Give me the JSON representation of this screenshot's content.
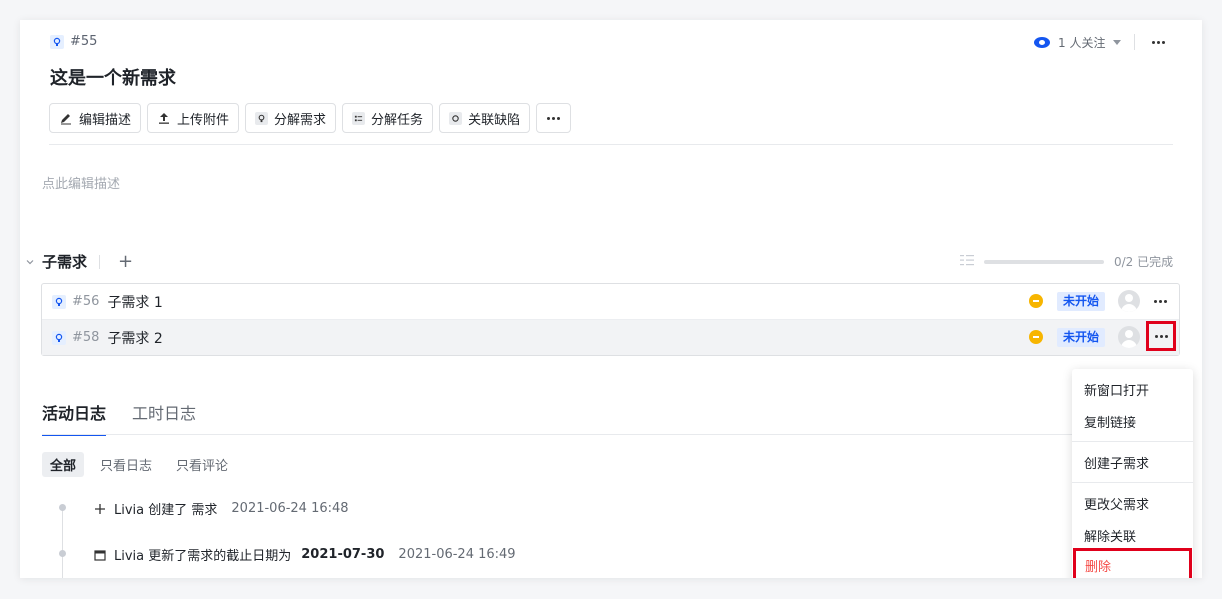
{
  "header": {
    "id": "#55",
    "title": "这是一个新需求",
    "watchers": "1 人关注"
  },
  "toolbar": {
    "edit_desc": "编辑描述",
    "upload": "上传附件",
    "split_req": "分解需求",
    "split_task": "分解任务",
    "link_bug": "关联缺陷"
  },
  "description": {
    "placeholder": "点此编辑描述"
  },
  "children": {
    "heading": "子需求",
    "progress": "0/2 已完成",
    "progress_value": 0,
    "items": [
      {
        "id": "#56",
        "name": "子需求 1",
        "status": "未开始"
      },
      {
        "id": "#58",
        "name": "子需求 2",
        "status": "未开始"
      }
    ]
  },
  "tabs": {
    "activity": "活动日志",
    "worklog": "工时日志"
  },
  "filters": {
    "all": "全部",
    "logs": "只看日志",
    "comments": "只看评论"
  },
  "logs": [
    {
      "text": "Livia 创建了 需求",
      "time": "2021-06-24 16:48",
      "icon": "plus-icon"
    },
    {
      "text": "Livia 更新了需求的截止日期为",
      "value": "2021-07-30",
      "time": "2021-06-24 16:49",
      "icon": "calendar-icon"
    }
  ],
  "menu": {
    "open_new": "新窗口打开",
    "copy_link": "复制链接",
    "create_child": "创建子需求",
    "change_parent": "更改父需求",
    "unlink": "解除关联",
    "delete": "删除"
  },
  "colors": {
    "accent": "#1456f0",
    "priority": "#f7b500",
    "danger": "#f54a45",
    "highlight_box": "#e0001b"
  }
}
